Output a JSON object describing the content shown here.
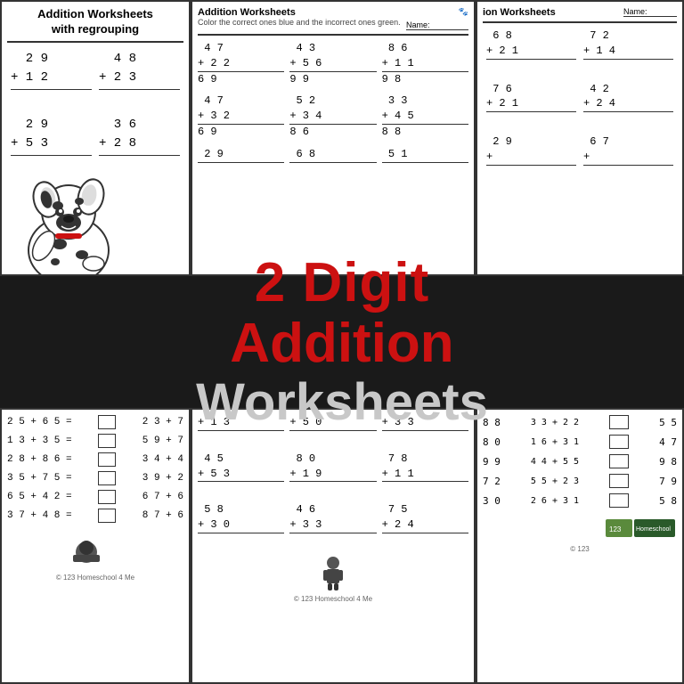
{
  "worksheets": {
    "left": {
      "title": "Addition Worksheets\nwith regrouping",
      "problems_top": [
        {
          "num1": "2 9",
          "op": "+",
          "num2": "1 2"
        },
        {
          "num1": "4 8",
          "op": "+",
          "num2": "2 3"
        }
      ],
      "problems_bottom": [
        {
          "num1": "2 9",
          "op": "+",
          "num2": "5 3"
        },
        {
          "num1": "3 6",
          "op": "+",
          "num2": "2 8"
        }
      ]
    },
    "middle_top": {
      "title": "Addition Worksheets",
      "instructions": "Color the correct ones blue and the incorrect ones green.",
      "name_label": "Name:",
      "rows": [
        [
          {
            "num1": "4 7",
            "op": "+",
            "num2": "2 2",
            "ans": "6 9"
          },
          {
            "num1": "4 3",
            "op": "+",
            "num2": "5 6",
            "ans": "9 9"
          },
          {
            "num1": "8 6",
            "op": "+",
            "num2": "1 1",
            "ans": "9 8"
          }
        ],
        [
          {
            "num1": "4 7",
            "op": "+",
            "num2": "3 2",
            "ans": "6 9"
          },
          {
            "num1": "5 2",
            "op": "+",
            "num2": "3 4",
            "ans": "8 6"
          },
          {
            "num1": "3 3",
            "op": "+",
            "num2": "4 5",
            "ans": "8 8"
          }
        ],
        [
          {
            "num1": "2 9",
            "ans": ""
          },
          {
            "num1": "6 8",
            "ans": ""
          },
          {
            "num1": "5 1",
            "ans": ""
          }
        ]
      ]
    },
    "right_top": {
      "title": "ion Worksheets",
      "name_label": "Name:",
      "rows": [
        [
          {
            "num1": "6 8",
            "op": "+",
            "num2": "2 1"
          },
          {
            "num1": "7 2",
            "op": "+",
            "num2": "1 4"
          }
        ],
        [
          {
            "num1": "7 6",
            "op": "+",
            "num2": "2 1"
          },
          {
            "num1": "4 2",
            "op": "+",
            "num2": "2 4"
          }
        ],
        [
          {
            "num1": "2 9",
            "op": "+",
            "num2": ""
          },
          {
            "num1": "6 7",
            "op": "+",
            "num2": ""
          }
        ]
      ]
    },
    "banner": {
      "line1": "2 Digit",
      "line2": "Addition",
      "line3": "Worksheets"
    },
    "bottom_left": {
      "equations": [
        {
          "eq": "2 5 + 6 5 =",
          "box": "",
          "eq2": "2 3 + 7"
        },
        {
          "eq": "1 3 + 3 5 =",
          "box": "",
          "eq2": "5 9 + 7"
        },
        {
          "eq": "2 8 + 8 6 =",
          "box": "",
          "eq2": "3 4 + 4"
        },
        {
          "eq": "3 5 + 7 5 =",
          "box": "",
          "eq2": "3 9 + 2"
        },
        {
          "eq": "6 5 + 4 2 =",
          "box": "",
          "eq2": "6 7 + 6"
        },
        {
          "eq": "3 7 + 4 8 =",
          "box": "",
          "eq2": "8 7 + 6"
        }
      ],
      "copyright": "© 123 Homeschool 4 Me"
    },
    "bottom_middle": {
      "rows_top": [
        {
          "op": "+ 1 3",
          "op2": "+ 5 0",
          "op3": "+ 3 3"
        }
      ],
      "rows_mid": [
        {
          "num1": "4 5",
          "op": "+ 5 3",
          "num2": "8 0",
          "op2": "+ 1 9",
          "num3": "7 8",
          "op3": "+ 1 1"
        }
      ],
      "rows_bot": [
        {
          "num1": "5 8",
          "op": "+ 3 0",
          "num2": "4 6",
          "op2": "+ 3 3",
          "num3": "7 5",
          "op3": "+ 2 4"
        }
      ],
      "copyright": "© 123 Homeschool 4 Me"
    },
    "bottom_right": {
      "rows": [
        {
          "val1": "8 8",
          "eq": "3 3 + 2 2",
          "box": "",
          "val2": "5 5"
        },
        {
          "val1": "8 0",
          "eq": "1 6 + 3 1",
          "box": "",
          "val2": "4 7"
        },
        {
          "val1": "9 9",
          "eq": "4 4 + 5 5",
          "box": "",
          "val2": "9 8"
        },
        {
          "val1": "7 2",
          "eq": "5 5 + 2 3",
          "box": "",
          "val2": "7 9"
        },
        {
          "val1": "3 0",
          "eq": "2 6 + 3 1",
          "box": "",
          "val2": "5 8"
        }
      ],
      "copyright": "© 123"
    }
  }
}
